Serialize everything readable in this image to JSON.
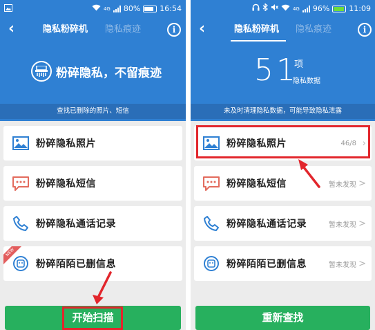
{
  "left": {
    "status": {
      "left_icon": "image-icon",
      "network": "4G",
      "battery": "80%",
      "time": "16:54"
    },
    "nav": {
      "tab_active": "隐私粉碎机",
      "tab_inactive": "隐私痕迹"
    },
    "hero": {
      "title": "粉碎隐私，不留痕迹"
    },
    "sub_band": "查找已删除的照片、短信",
    "items": [
      {
        "label": "粉碎隐私照片",
        "icon": "image-icon"
      },
      {
        "label": "粉碎隐私短信",
        "icon": "message-icon"
      },
      {
        "label": "粉碎隐私通话记录",
        "icon": "phone-icon"
      },
      {
        "label": "粉碎陌陌已删信息",
        "icon": "momo-icon",
        "ribbon": "NEW"
      }
    ],
    "button": "开始扫描"
  },
  "right": {
    "status": {
      "network": "4G",
      "battery": "96%",
      "time": "11:09"
    },
    "nav": {
      "tab_active": "隐私粉碎机",
      "tab_inactive": "隐私痕迹"
    },
    "count": {
      "value": "51",
      "unit": "项",
      "label": "隐私数据"
    },
    "sub_band": "未及时清理隐私数据，可能导致隐私泄露",
    "items": [
      {
        "label": "粉碎隐私照片",
        "icon": "image-icon",
        "status": "46/8",
        "chevron": "›"
      },
      {
        "label": "粉碎隐私短信",
        "icon": "message-icon",
        "status": "暂未发现",
        "chevron": ">"
      },
      {
        "label": "粉碎隐私通话记录",
        "icon": "phone-icon",
        "status": "暂未发现",
        "chevron": ">"
      },
      {
        "label": "粉碎陌陌已删信息",
        "icon": "momo-icon",
        "status": "暂未发现",
        "chevron": ">"
      }
    ],
    "button": "重新查找"
  },
  "colors": {
    "primary_blue": "#2f80d3",
    "band_blue": "#2a6eb8",
    "button_green": "#27b05e",
    "highlight_red": "#e2262c"
  }
}
